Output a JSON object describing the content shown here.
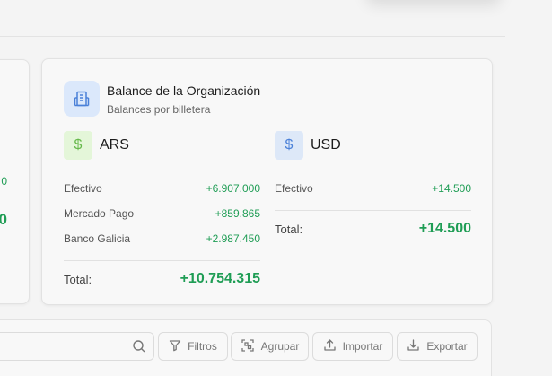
{
  "left_card": {
    "value_small": "0",
    "value_big": "0"
  },
  "balance_card": {
    "title": "Balance de la Organización",
    "subtitle": "Balances por billetera",
    "ars": {
      "symbol": "$",
      "code": "ARS",
      "rows": [
        {
          "label": "Efectivo",
          "amount": "+6.907.000"
        },
        {
          "label": "Mercado Pago",
          "amount": "+859.865"
        },
        {
          "label": "Banco Galicia",
          "amount": "+2.987.450"
        }
      ],
      "total_label": "Total:",
      "total_amount": "+10.754.315"
    },
    "usd": {
      "symbol": "$",
      "code": "USD",
      "rows": [
        {
          "label": "Efectivo",
          "amount": "+14.500"
        }
      ],
      "total_label": "Total:",
      "total_amount": "+14.500"
    }
  },
  "toolbar": {
    "filtros": "Filtros",
    "agrupar": "Agrupar",
    "importar": "Importar",
    "exportar": "Exportar"
  },
  "colors": {
    "positive": "#1f9d55",
    "ars_icon_bg": "#e4f6d9",
    "usd_icon_bg": "#dde8f8"
  }
}
